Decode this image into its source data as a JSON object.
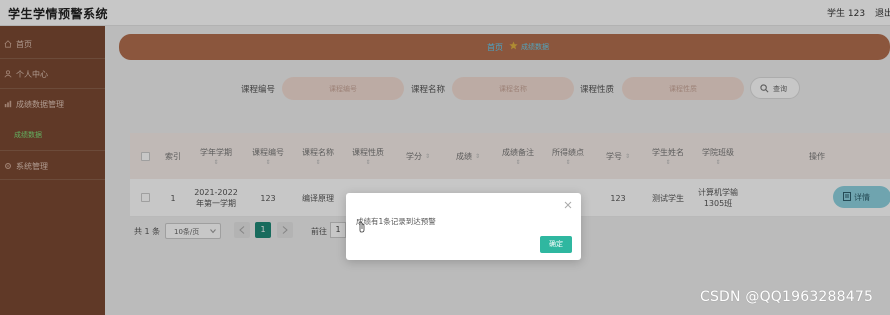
{
  "header": {
    "title": "学生学情预警系统",
    "user": "学生 123",
    "logout": "退出"
  },
  "sidebar": {
    "items": [
      {
        "label": "首页",
        "icon": "home-icon"
      },
      {
        "label": "个人中心",
        "icon": "user-icon"
      },
      {
        "label": "成绩数据管理",
        "icon": "chart-icon"
      },
      {
        "label": "系统管理",
        "icon": "settings-icon"
      }
    ],
    "sub_item": "成绩数据"
  },
  "breadcrumb": {
    "home": "首页",
    "current": "成绩数据",
    "separator_icon": "star-icon"
  },
  "search": {
    "fields": [
      {
        "label": "课程编号",
        "placeholder": "课程编号"
      },
      {
        "label": "课程名称",
        "placeholder": "课程名称"
      },
      {
        "label": "课程性质",
        "placeholder": "课程性质"
      }
    ],
    "button": "查询"
  },
  "table": {
    "columns": [
      "索引",
      "学年学期",
      "课程编号",
      "课程名称",
      "课程性质",
      "学分",
      "成绩",
      "成绩备注",
      "所得绩点",
      "学号",
      "学生姓名",
      "学院班级",
      "操作"
    ],
    "row": {
      "index": "1",
      "term": "2021-2022年第一学期",
      "course_no": "123",
      "course_name": "编译原理",
      "student_no": "123",
      "student_name": "测试学生",
      "class": "计算机学输1305班"
    },
    "detail_button": "详情"
  },
  "pagination": {
    "total": "共 1 条",
    "page_size": "10条/页",
    "current_page": "1",
    "goto_label": "前往",
    "goto_value": "1"
  },
  "dialog": {
    "message": "成绩有1条记录到达预警",
    "ok": "确定"
  },
  "watermark": "CSDN @QQ1963288475",
  "colors": {
    "sidebar": "#7b4a33",
    "breadcrumb": "#b26f4f",
    "accent": "#2fb7a0",
    "input": "#f1dcd3"
  }
}
